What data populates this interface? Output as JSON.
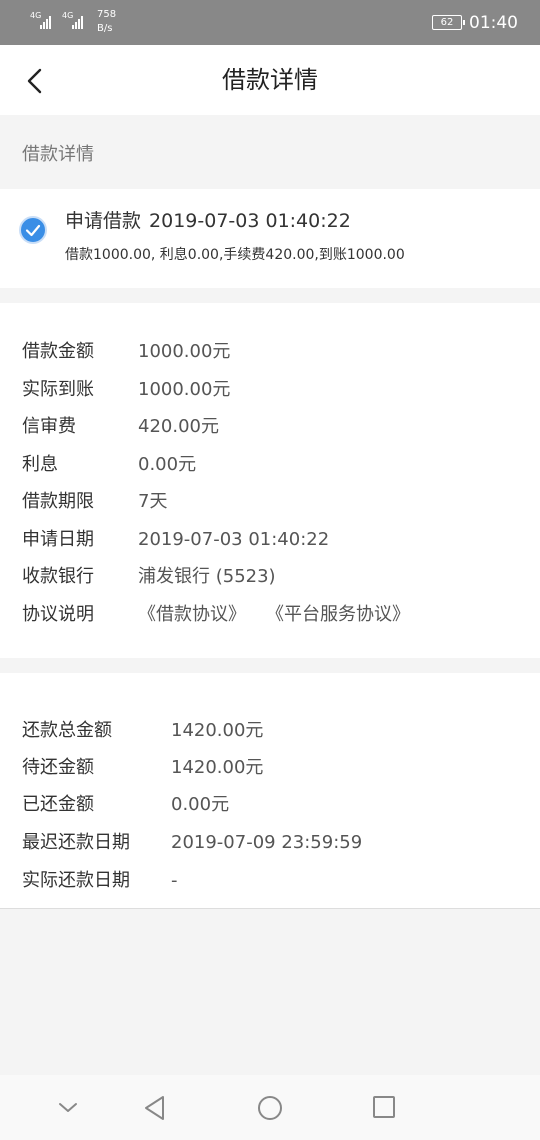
{
  "status_bar": {
    "signal1_label": "4G",
    "signal2_label": "4G",
    "net_speed_value": "758",
    "net_speed_unit": "B/s",
    "battery": "62",
    "time": "01:40"
  },
  "nav": {
    "title": "借款详情",
    "back_icon": "chevron-left-icon"
  },
  "section_header": "借款详情",
  "status_card": {
    "icon": "check-circle-icon",
    "accent": "#3a8ee6",
    "title": "申请借款",
    "datetime": "2019-07-03 01:40:22",
    "summary": "借款1000.00, 利息0.00,手续费420.00,到账1000.00"
  },
  "loan_info": [
    {
      "key": "借款金额",
      "value": "1000.00元"
    },
    {
      "key": "实际到账",
      "value": "1000.00元"
    },
    {
      "key": "信审费",
      "value": "420.00元"
    },
    {
      "key": "利息",
      "value": "0.00元"
    },
    {
      "key": "借款期限",
      "value": "7天"
    },
    {
      "key": "申请日期",
      "value": "2019-07-03 01:40:22"
    },
    {
      "key": "收款银行",
      "value": "浦发银行 (5523)"
    }
  ],
  "agreement": {
    "key": "协议说明",
    "link1": "《借款协议》",
    "link2": "《平台服务协议》",
    "link_color": "#2d8ee0"
  },
  "repayment": [
    {
      "key": "还款总金额",
      "value": "1420.00元"
    },
    {
      "key": "待还金额",
      "value": "1420.00元"
    },
    {
      "key": "已还金额",
      "value": "0.00元"
    },
    {
      "key": "最迟还款日期",
      "value": "2019-07-09 23:59:59"
    },
    {
      "key": "实际还款日期",
      "value": "-"
    }
  ],
  "system_nav": {
    "icons": [
      "chevron-down-icon",
      "back-triangle-icon",
      "home-circle-icon",
      "recents-square-icon"
    ]
  }
}
